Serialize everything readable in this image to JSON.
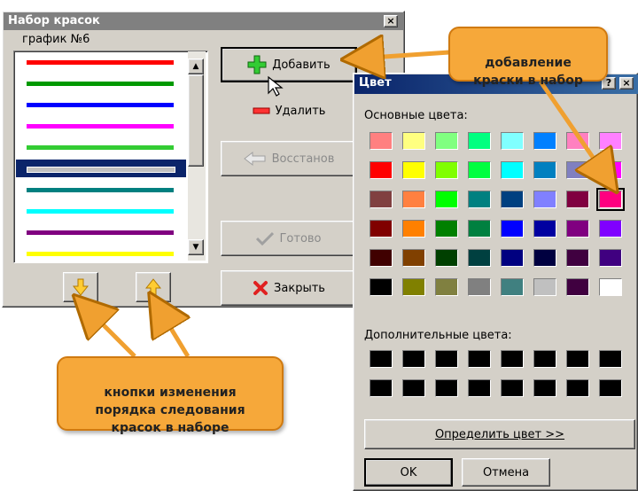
{
  "palette_window": {
    "title": "Набор красок",
    "close_glyph": "×",
    "list_label": "график №6",
    "lines": [
      "#ff0000",
      "#009900",
      "#0000ff",
      "#ff00ff",
      "#33cc33",
      "#c0c0c0",
      "#008080",
      "#00ffff",
      "#800080",
      "#ffff00"
    ],
    "selected_line_index": 5,
    "buttons": {
      "add": "Добавить",
      "delete": "Удалить",
      "restore": "Восстанов",
      "done": "Готово",
      "close": "Закрыть"
    }
  },
  "color_dialog": {
    "title": "Цвет",
    "help_glyph": "?",
    "close_glyph": "×",
    "basic_label": "Основные цвета:",
    "custom_label": "Дополнительные цвета:",
    "define_button": "Определить цвет >>",
    "ok_button": "OK",
    "cancel_button": "Отмена",
    "basic_colors": [
      [
        "#ff8080",
        "#ffff80",
        "#80ff80",
        "#00ff80",
        "#80ffff",
        "#0080ff",
        "#ff80c0",
        "#ff80ff"
      ],
      [
        "#ff0000",
        "#ffff00",
        "#80ff00",
        "#00ff40",
        "#00ffff",
        "#0080c0",
        "#8080c0",
        "#ff00ff"
      ],
      [
        "#804040",
        "#ff8040",
        "#00ff00",
        "#008080",
        "#004080",
        "#8080ff",
        "#800040",
        "#ff0080"
      ],
      [
        "#800000",
        "#ff8000",
        "#008000",
        "#008040",
        "#0000ff",
        "#0000a0",
        "#800080",
        "#8000ff"
      ],
      [
        "#400000",
        "#804000",
        "#004000",
        "#004040",
        "#000080",
        "#000040",
        "#400040",
        "#400080"
      ],
      [
        "#000000",
        "#808000",
        "#808040",
        "#808080",
        "#408080",
        "#c0c0c0",
        "#400040",
        "#ffffff"
      ]
    ],
    "selected_swatch": [
      2,
      7
    ],
    "custom_colors": [
      [
        "#000000",
        "#000000",
        "#000000",
        "#000000",
        "#000000",
        "#000000",
        "#000000",
        "#000000"
      ],
      [
        "#000000",
        "#000000",
        "#000000",
        "#000000",
        "#000000",
        "#000000",
        "#000000",
        "#000000"
      ]
    ]
  },
  "callouts": {
    "add_paint": "добавление\nкраски в набор",
    "order_buttons": "кнопки изменения\nпорядка следования\nкрасок в наборе"
  },
  "icons": {
    "add": "plus-icon",
    "delete": "minus-icon",
    "restore": "undo-arrow-icon",
    "done": "checkmark-icon",
    "close": "x-icon",
    "move_down": "arrow-down-icon",
    "move_up": "arrow-up-icon",
    "cursor": "mouse-pointer-icon"
  },
  "colors": {
    "titlebar_active": "#0a246a",
    "titlebar_inactive": "#808080",
    "callout": "#f6a83a"
  }
}
